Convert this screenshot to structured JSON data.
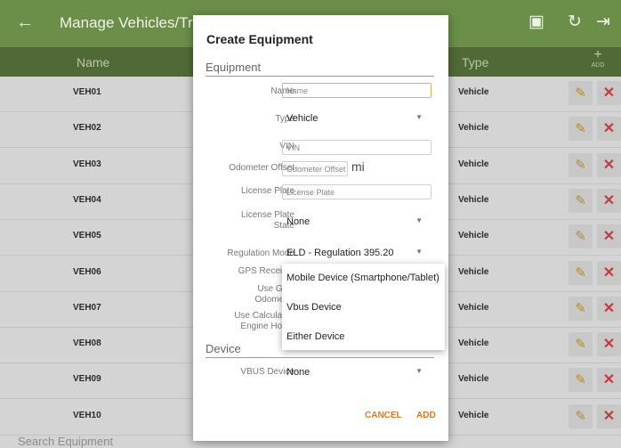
{
  "appbar": {
    "title": "Manage Vehicles/Trailers"
  },
  "table": {
    "headers": {
      "name": "Name",
      "type": "Type",
      "add": "+",
      "add_small": "ADD"
    },
    "rows": [
      {
        "name": "VEH01",
        "type": "Vehicle"
      },
      {
        "name": "VEH02",
        "type": "Vehicle"
      },
      {
        "name": "VEH03",
        "type": "Vehicle"
      },
      {
        "name": "VEH04",
        "type": "Vehicle"
      },
      {
        "name": "VEH05",
        "type": "Vehicle"
      },
      {
        "name": "VEH06",
        "type": "Vehicle"
      },
      {
        "name": "VEH07",
        "type": "Vehicle"
      },
      {
        "name": "VEH08",
        "type": "Vehicle"
      },
      {
        "name": "VEH09",
        "type": "Vehicle"
      },
      {
        "name": "VEH10",
        "type": "Vehicle"
      }
    ]
  },
  "search": {
    "placeholder": "Search Equipment"
  },
  "dialog": {
    "title": "Create Equipment",
    "section_equipment": "Equipment",
    "section_device": "Device",
    "labels": {
      "name": "Name",
      "type": "Type",
      "vin": "VIN",
      "odometer_offset": "Odometer Offset",
      "license_plate": "License Plate",
      "license_plate_state_1": "License Plate",
      "license_plate_state_2": "State",
      "regulation_mode": "Regulation Mode",
      "gps_receiver": "GPS Receiver",
      "use_gps_odometer_1": "Use GPS",
      "use_gps_odometer_2": "Odometer",
      "use_calc_hours_1": "Use Calculated",
      "use_calc_hours_2": "Engine Hours",
      "vbus_device": "VBUS Device"
    },
    "fields": {
      "name_placeholder": "Name",
      "type_value": "Vehicle",
      "vin_placeholder": "VIN",
      "odometer_placeholder": "Odometer Offset",
      "odometer_unit": "mi",
      "license_plate_placeholder": "License Plate",
      "license_plate_state_value": "None",
      "regulation_mode_value": "ELD - Regulation 395.20",
      "vbus_device_value": "None"
    },
    "dropdown": {
      "options": [
        "Mobile Device (Smartphone/Tablet)",
        "Vbus Device",
        "Either Device"
      ]
    },
    "buttons": {
      "cancel": "CANCEL",
      "add": "ADD"
    }
  },
  "icons": [
    "back-arrow-icon",
    "import-icon",
    "refresh-icon",
    "logout-icon",
    "pencil-icon",
    "delete-x-icon"
  ]
}
